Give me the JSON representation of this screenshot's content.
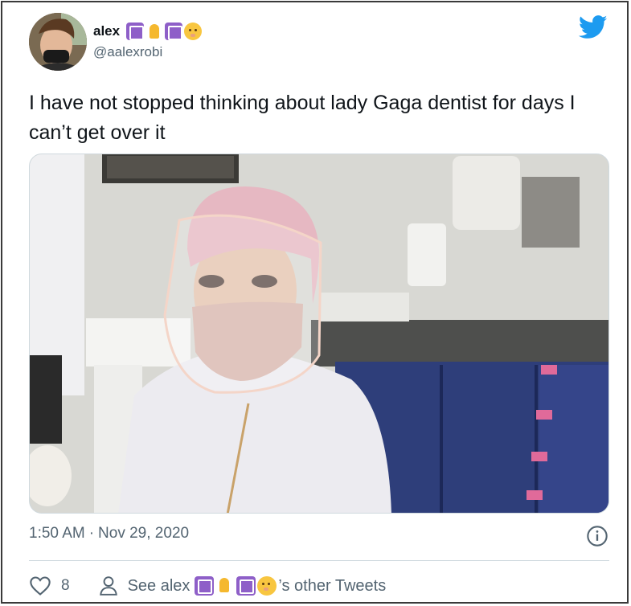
{
  "tweet": {
    "display_name": "alex",
    "name_emojis": [
      "sign-of-the-horns-square-emoji",
      "folded-hands-emoji",
      "aquarius-emoji",
      "shushing-face-emoji"
    ],
    "handle": "@aalexrobi",
    "text": "I have not stopped thinking about lady Gaga dentist for days I can’t get over it",
    "time": "1:50 AM",
    "separator": "·",
    "date": "Nov 29, 2020",
    "like_count": "8",
    "see_prefix": "See alex",
    "see_suffix": "’s other Tweets"
  },
  "icons": {
    "brand": "twitter-bird-icon",
    "info": "info-icon",
    "like": "heart-icon",
    "profile": "person-icon"
  },
  "colors": {
    "brand": "#1d9bf0",
    "text_primary": "#0f1419",
    "text_secondary": "#536471",
    "border": "#cfd9de"
  }
}
